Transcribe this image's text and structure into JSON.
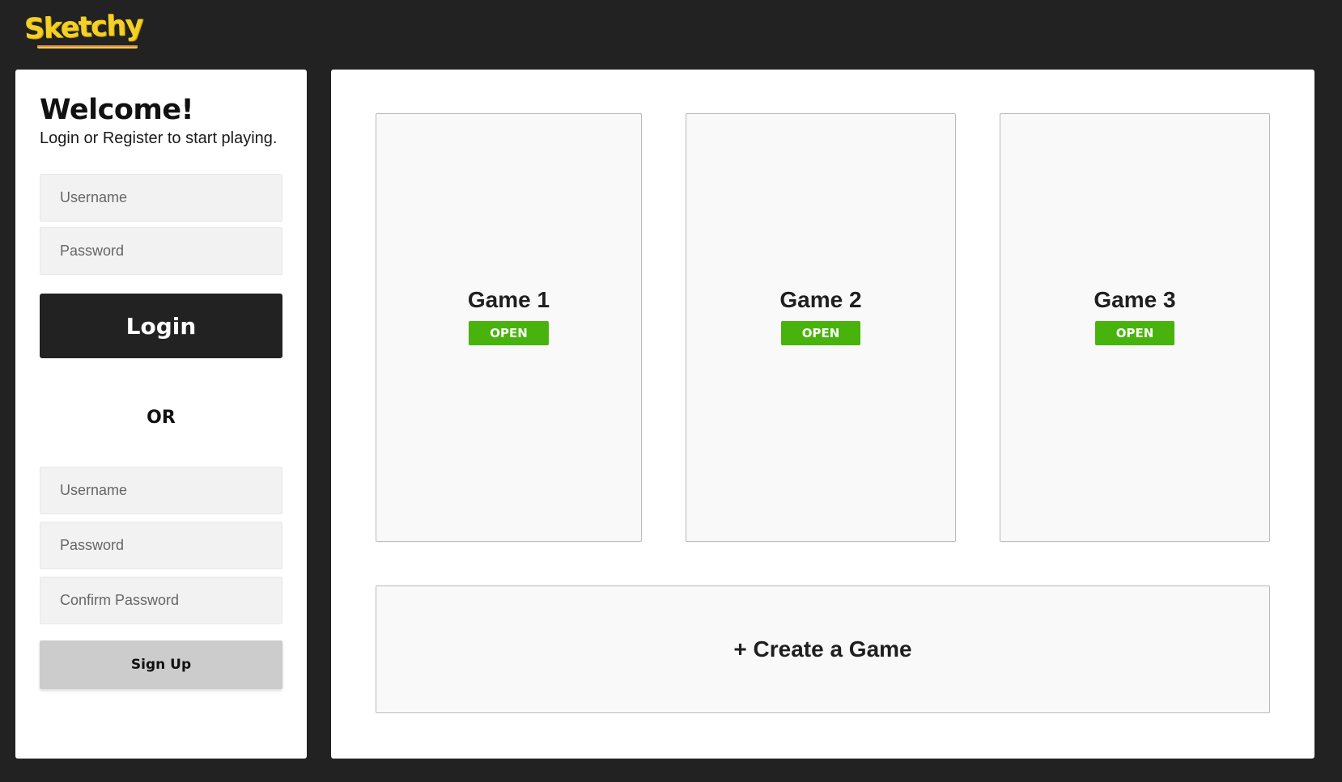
{
  "brand": {
    "name": "Sketchy"
  },
  "auth": {
    "title": "Welcome!",
    "subtitle": "Login or Register to start playing.",
    "login": {
      "username_placeholder": "Username",
      "password_placeholder": "Password",
      "button_label": "Login"
    },
    "divider_label": "OR",
    "register": {
      "username_placeholder": "Username",
      "password_placeholder": "Password",
      "confirm_placeholder": "Confirm Password",
      "button_label": "Sign Up"
    }
  },
  "games": [
    {
      "title": "Game 1",
      "status": "OPEN"
    },
    {
      "title": "Game 2",
      "status": "OPEN"
    },
    {
      "title": "Game 3",
      "status": "OPEN"
    }
  ],
  "create_game_label": "+ Create a Game",
  "colors": {
    "background": "#222222",
    "brand_yellow": "#f4cf26",
    "open_green": "#48b30c",
    "login_button": "#222222",
    "signup_button": "#cccccc"
  }
}
